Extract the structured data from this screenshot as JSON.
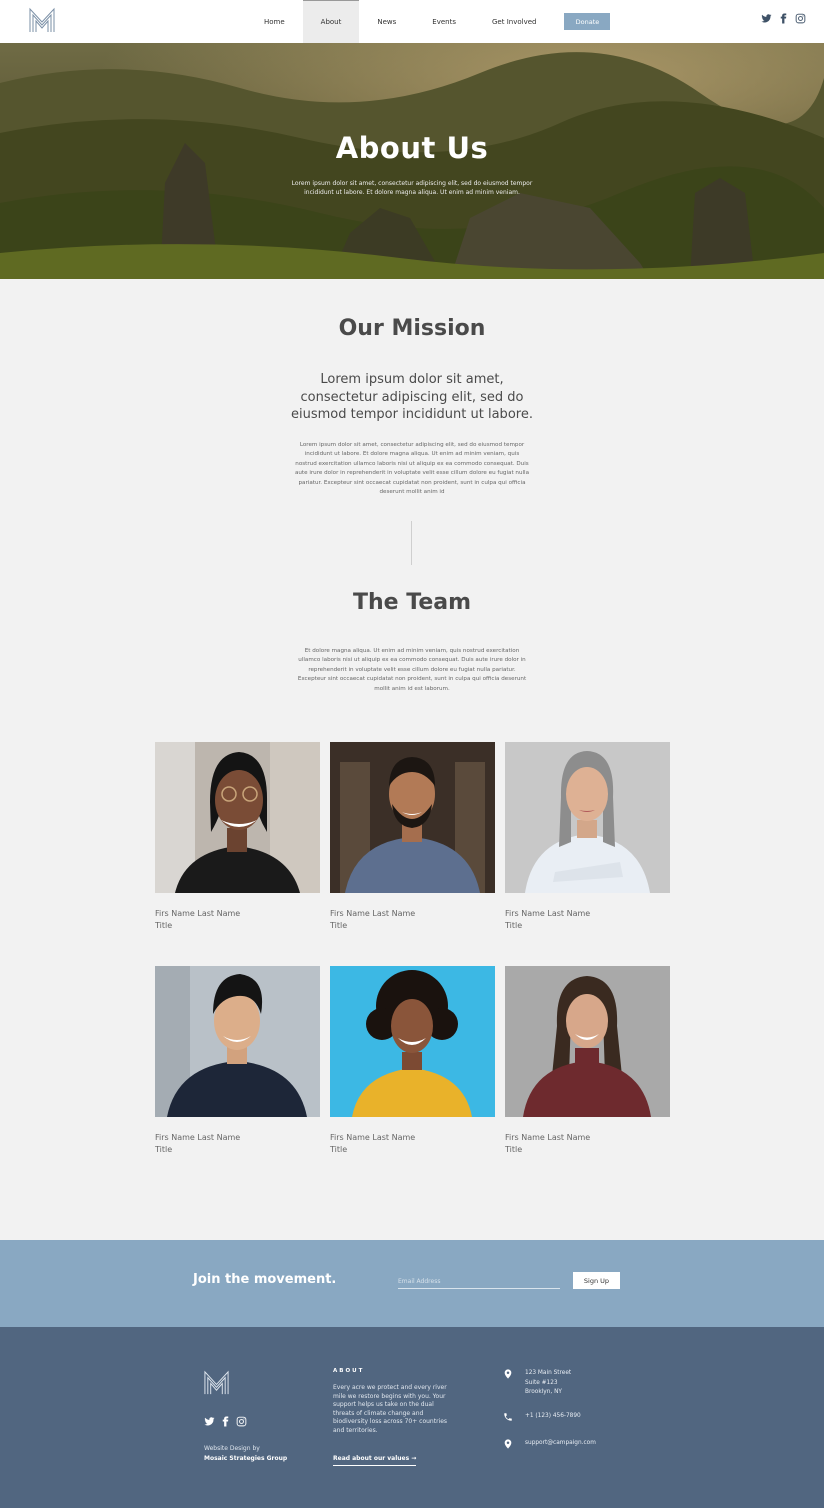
{
  "header": {
    "nav": [
      "Home",
      "About",
      "News",
      "Events",
      "Get Involved"
    ],
    "active_nav": "About",
    "donate_label": "Donate",
    "socials": [
      "twitter-icon",
      "facebook-icon",
      "instagram-icon"
    ]
  },
  "hero": {
    "title": "About Us",
    "text": "Lorem ipsum dolor sit amet, consectetur adipiscing elit, sed do eiusmod tempor incididunt ut labore. Et dolore magna aliqua. Ut enim ad minim veniam."
  },
  "mission": {
    "title": "Our Mission",
    "lead": "Lorem ipsum dolor sit amet, consectetur adipiscing elit, sed do eiusmod tempor incididunt ut labore.",
    "body": "Lorem ipsum dolor sit amet, consectetur adipiscing elit, sed do eiusmod tempor incididunt ut labore. Et dolore magna aliqua. Ut enim ad minim veniam, quis nostrud exercitation ullamco laboris nisi ut aliquip ex ea commodo consequat. Duis aute irure dolor in reprehenderit in voluptate velit esse cillum dolore eu fugiat nulla pariatur. Excepteur sint occaecat cupidatat non proident, sunt in culpa qui officia deserunt mollit anim id"
  },
  "team": {
    "title": "The Team",
    "body": "Et dolore magna aliqua. Ut enim ad minim veniam, quis nostrud exercitation ullamco laboris nisi ut aliquip ex ea commodo consequat. Duis aute irure dolor in reprehenderit in voluptate velit esse cillum dolore eu fugiat nulla pariatur. Excepteur sint occaecat cupidatat non proident, sunt in culpa qui officia deserunt mollit anim id est laborum.",
    "members": [
      {
        "name": "Firs Name Last Name",
        "title": "Title"
      },
      {
        "name": "Firs Name Last Name",
        "title": "Title"
      },
      {
        "name": "Firs Name Last Name",
        "title": "Title"
      },
      {
        "name": "Firs Name Last Name",
        "title": "Title"
      },
      {
        "name": "Firs Name Last Name",
        "title": "Title"
      },
      {
        "name": "Firs Name Last Name",
        "title": "Title"
      }
    ]
  },
  "join": {
    "title": "Join the movement.",
    "email_placeholder": "Email Address",
    "signup_label": "Sign Up"
  },
  "footer": {
    "credit_line1": "Website Design by",
    "credit_line2": "Mosaic Strategies Group",
    "about_heading": "ABOUT",
    "about_text": "Every acre we protect and every river mile we restore begins with you. Your support helps us take on the dual threats of climate change and biodiversity loss across 70+ countries and territories.",
    "about_link": "Read about our values →",
    "address_line1": "123 Main Street",
    "address_line2": "Suite #123",
    "address_line3": "Brooklyn, NY",
    "phone": "+1 (123) 456-7890",
    "email": "support@campaign.com"
  },
  "colors": {
    "accent": "#89a8c2",
    "footer_bg": "#516680",
    "page_bg": "#f2f2f2"
  }
}
